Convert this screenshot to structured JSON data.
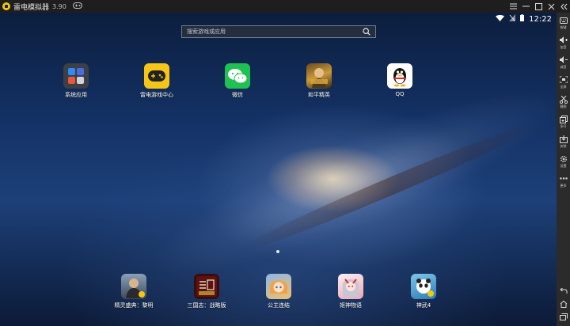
{
  "window": {
    "title": "雷电模拟器",
    "version": "3.90",
    "controls": [
      "menu",
      "minimize",
      "maximize",
      "close",
      "collapse"
    ]
  },
  "status": {
    "time": "12:22"
  },
  "search": {
    "placeholder": "搜索游戏或应用"
  },
  "desktop_apps": [
    {
      "label": "系统应用",
      "icon": "system-apps-folder-icon"
    },
    {
      "label": "雷电游戏中心",
      "icon": "leidian-game-center-icon"
    },
    {
      "label": "微信",
      "icon": "wechat-icon"
    },
    {
      "label": "和平精英",
      "icon": "peace-elite-icon"
    },
    {
      "label": "QQ",
      "icon": "qq-penguin-icon"
    }
  ],
  "dock_apps": [
    {
      "label": "精灵盛典：黎明",
      "icon": "elf-festival-icon"
    },
    {
      "label": "三国志：战略版",
      "icon": "three-kingdoms-icon"
    },
    {
      "label": "公主连结",
      "icon": "princess-connect-icon"
    },
    {
      "label": "姬神物语",
      "icon": "ji-shen-wuyu-icon"
    },
    {
      "label": "神武4",
      "icon": "shenwu4-icon"
    }
  ],
  "sidebar": [
    {
      "label": "按键",
      "icon": "keyboard-icon"
    },
    {
      "label": "加音",
      "icon": "volume-up-icon"
    },
    {
      "label": "减音",
      "icon": "volume-down-icon"
    },
    {
      "label": "全屏",
      "icon": "fullscreen-icon"
    },
    {
      "label": "截图",
      "icon": "scissors-icon"
    },
    {
      "label": "多开",
      "icon": "multi-instance-icon"
    },
    {
      "label": "安装",
      "icon": "install-apk-icon"
    },
    {
      "label": "设置",
      "icon": "gear-icon"
    },
    {
      "label": "更多",
      "icon": "more-dots-icon"
    }
  ],
  "nav": [
    "back-icon",
    "home-icon",
    "recents-icon"
  ],
  "colors": {
    "accent": "#f2c811",
    "titlebar": "#1e1e1e",
    "sidebar": "#2b2b2b"
  }
}
